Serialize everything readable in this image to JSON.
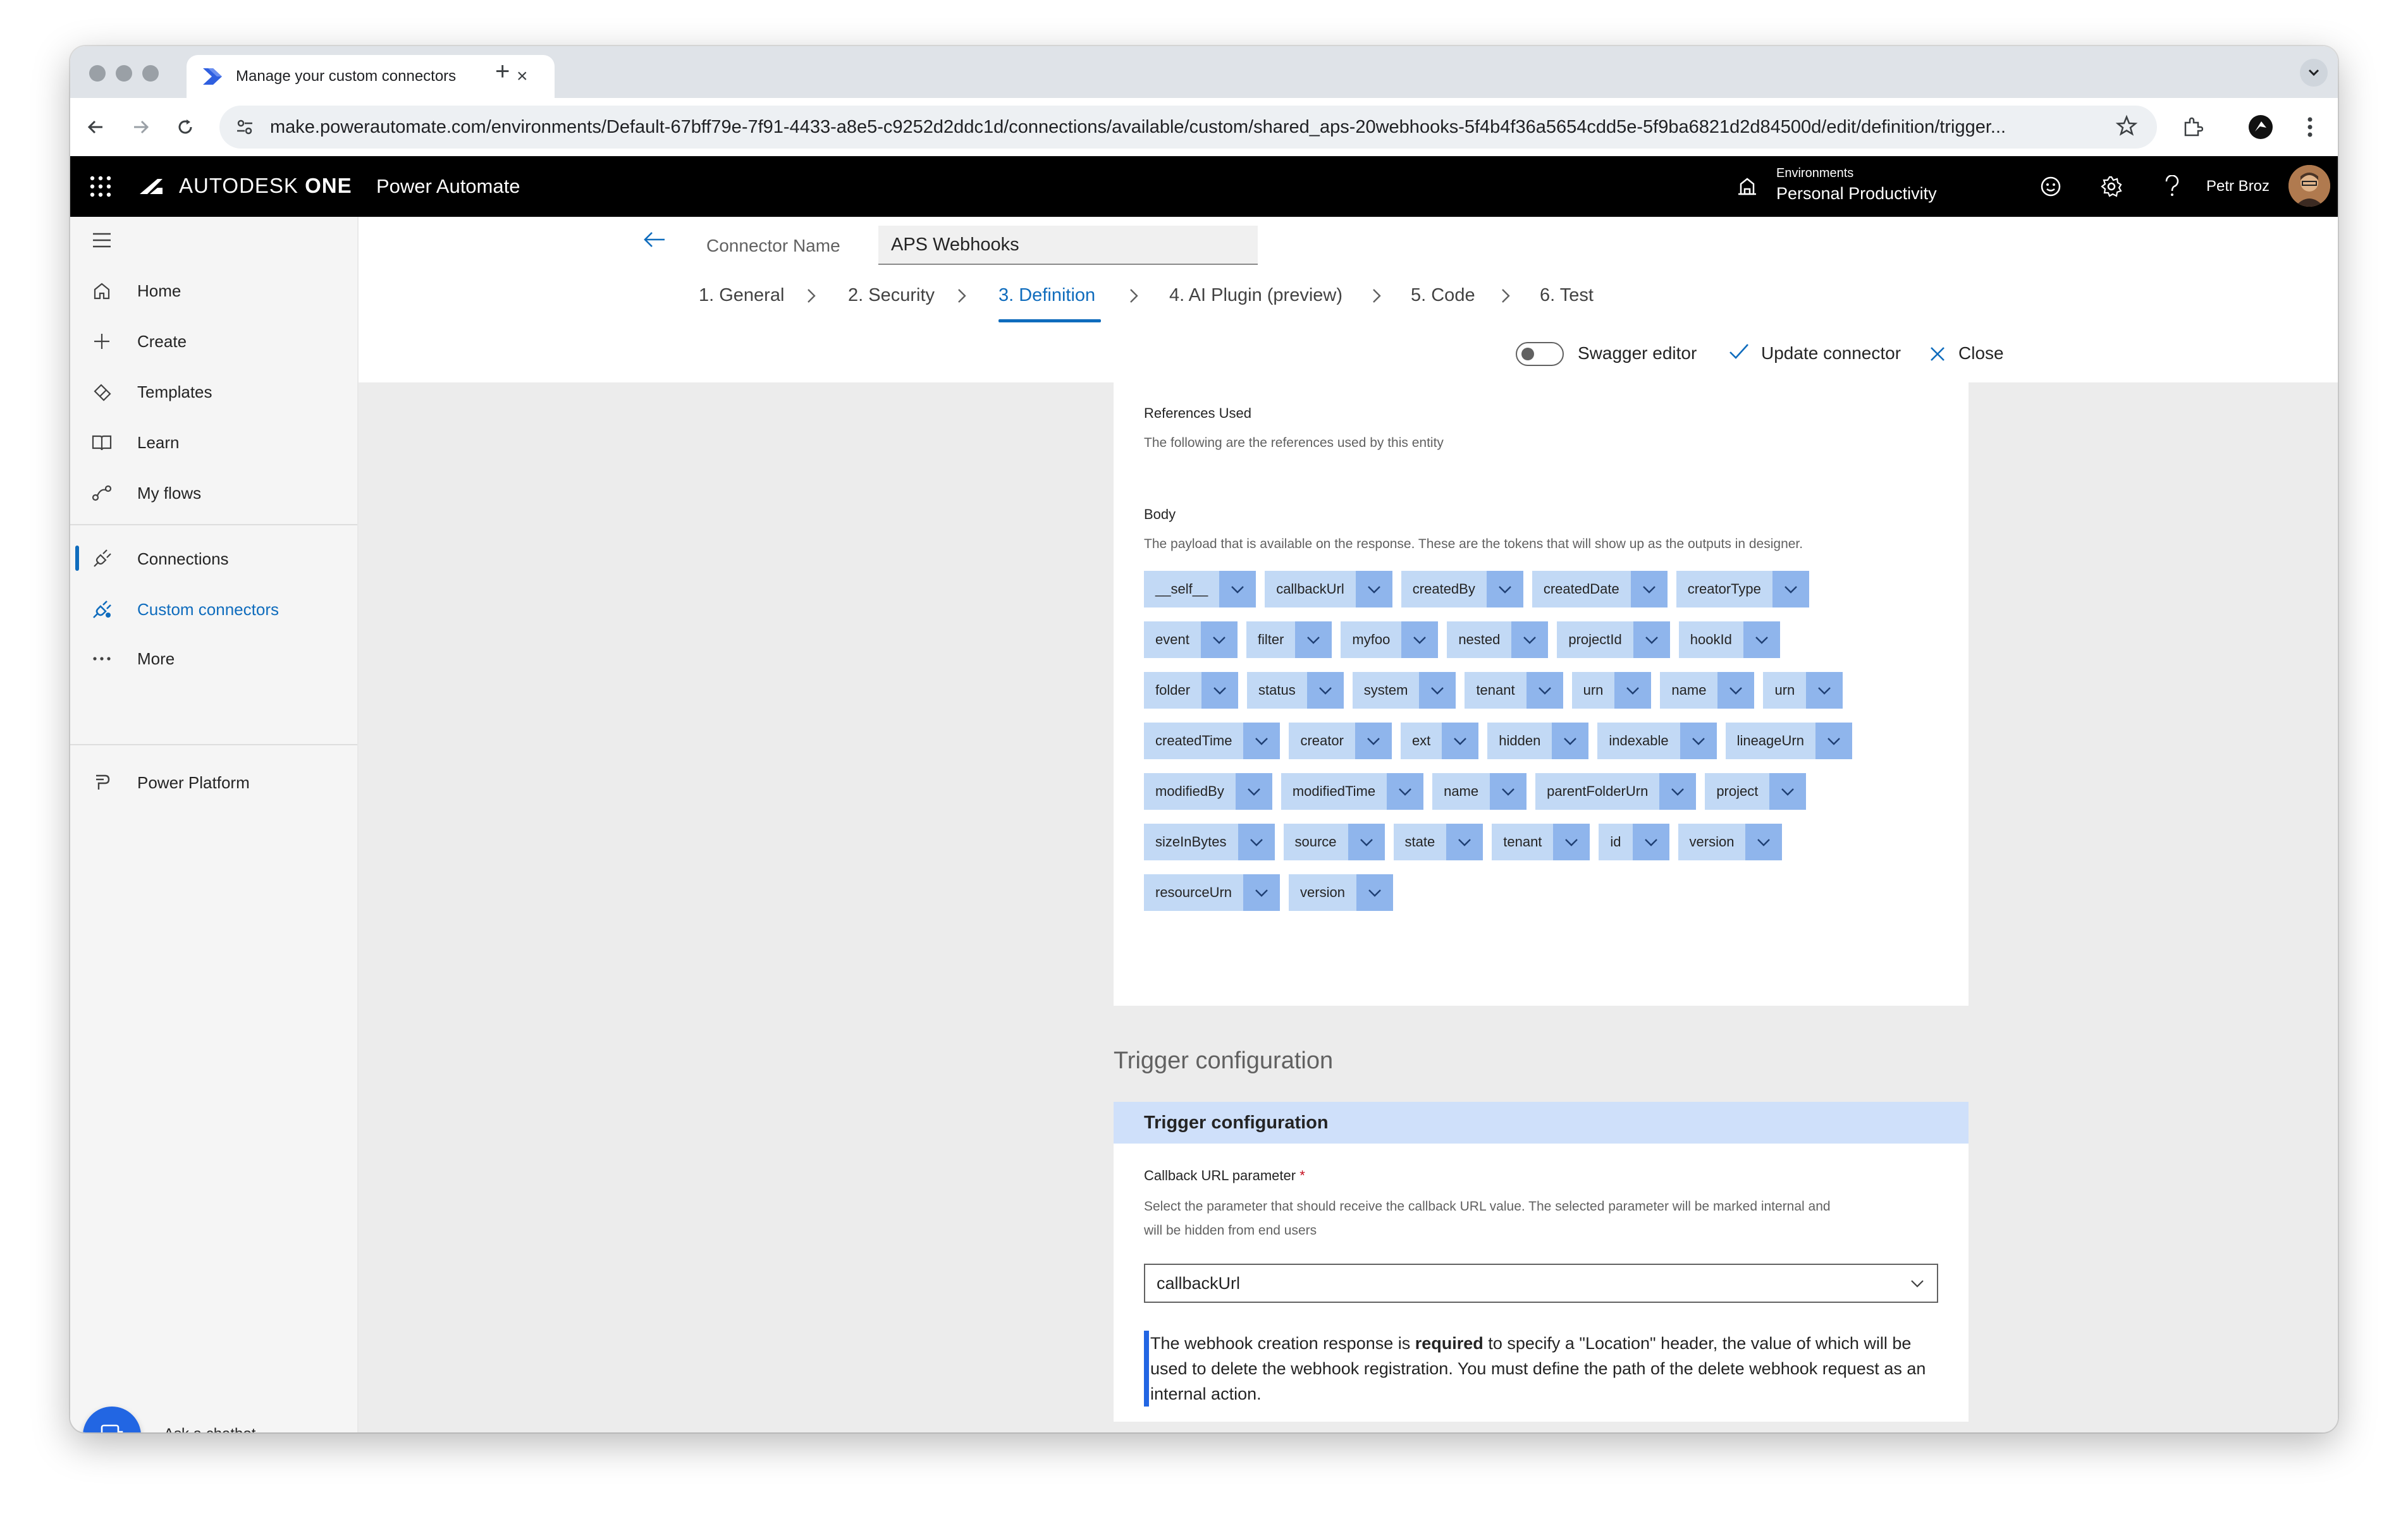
{
  "browser": {
    "tab_title": "Manage your custom connectors",
    "tab_close": "×",
    "new_tab": "+",
    "url": "make.powerautomate.com/environments/Default-67bff79e-7f91-4433-a8e5-c9252d2ddc1d/connections/available/custom/shared_aps-20webhooks-5f4b4f36a5654cdd5e-5f9ba6821d2d84500d/edit/definition/trigger..."
  },
  "app_header": {
    "brand": "AUTODESK",
    "brand_bold": "ONE",
    "product": "Power Automate",
    "env_label": "Environments",
    "env_value": "Personal Productivity",
    "user_name": "Petr Broz"
  },
  "left_nav": {
    "items": [
      {
        "label": "Home",
        "icon": "home-icon"
      },
      {
        "label": "Create",
        "icon": "plus-icon"
      },
      {
        "label": "Templates",
        "icon": "templates-icon"
      },
      {
        "label": "Learn",
        "icon": "book-icon"
      },
      {
        "label": "My flows",
        "icon": "flow-icon"
      },
      {
        "label": "Connections",
        "icon": "plug-icon"
      },
      {
        "label": "Custom connectors",
        "icon": "custom-connector-icon"
      },
      {
        "label": "More",
        "icon": "more-icon"
      },
      {
        "label": "Power Platform",
        "icon": "power-platform-icon"
      }
    ],
    "active_item": "Custom connectors",
    "chatbot_label": "Ask a chatbot"
  },
  "connector": {
    "name_label": "Connector Name",
    "name_value": "APS Webhooks",
    "steps": [
      "1. General",
      "2. Security",
      "3. Definition",
      "4. AI Plugin (preview)",
      "5. Code",
      "6. Test"
    ],
    "active_step": "3. Definition",
    "swagger_label": "Swagger editor",
    "update_label": "Update connector",
    "close_label": "Close"
  },
  "references": {
    "title": "References Used",
    "description": "The following are the references used by this entity"
  },
  "body": {
    "title": "Body",
    "description": "The payload that is available on the response. These are the tokens that will show up as the outputs in designer.",
    "tokens": [
      [
        "__self__",
        "callbackUrl",
        "createdBy",
        "createdDate",
        "creatorType"
      ],
      [
        "event",
        "filter",
        "myfoo",
        "nested",
        "projectId",
        "hookId"
      ],
      [
        "folder",
        "status",
        "system",
        "tenant",
        "urn",
        "name",
        "urn"
      ],
      [
        "createdTime",
        "creator",
        "ext",
        "hidden",
        "indexable",
        "lineageUrn"
      ],
      [
        "modifiedBy",
        "modifiedTime",
        "name",
        "parentFolderUrn",
        "project"
      ],
      [
        "sizeInBytes",
        "source",
        "state",
        "tenant",
        "id",
        "version"
      ],
      [
        "resourceUrn",
        "version"
      ]
    ]
  },
  "trigger": {
    "section_title": "Trigger configuration",
    "card_title": "Trigger configuration",
    "callback_label": "Callback URL parameter",
    "required_mark": "*",
    "callback_desc_1": "Select the parameter that should receive the callback URL value. The selected parameter will be marked internal and",
    "callback_desc_2": "will be hidden from end users",
    "callback_value": "callbackUrl",
    "note_1": "The webhook creation response is",
    "note_bold": "required",
    "note_2": "to specify a \"Location\" header, the value of which will be used to delete the webhook registration. You must define the path of the delete webhook request as an internal action."
  },
  "colors": {
    "accent": "#0f6cbd",
    "token_bg": "#c2d9f5",
    "token_dd": "#8fb5ec",
    "header_bg": "#000000"
  }
}
